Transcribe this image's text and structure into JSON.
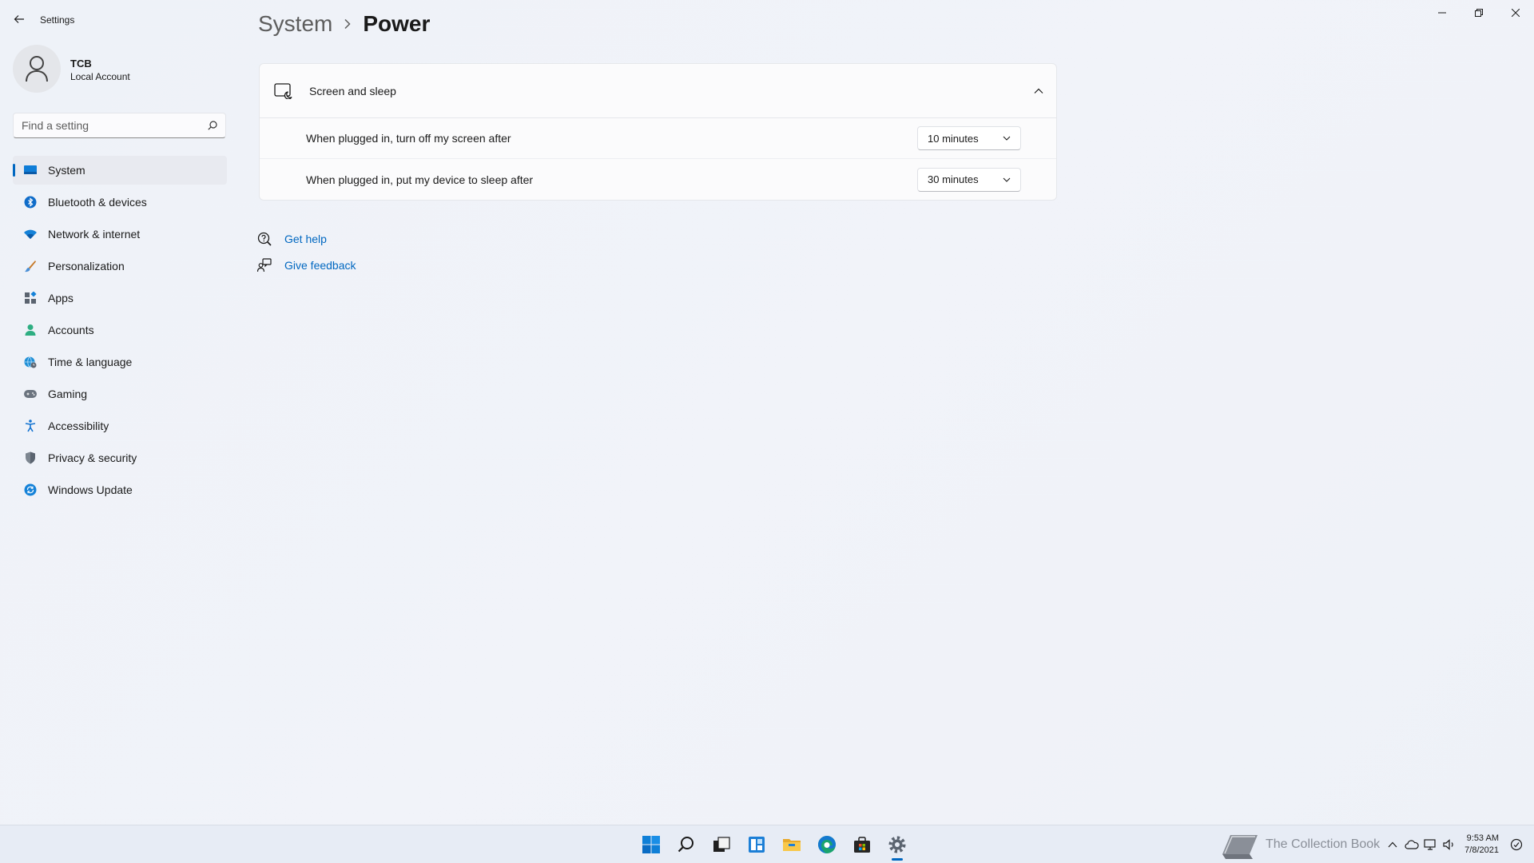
{
  "window": {
    "app_title": "Settings"
  },
  "profile": {
    "name": "TCB",
    "account_type": "Local Account"
  },
  "search": {
    "placeholder": "Find a setting"
  },
  "sidebar": {
    "items": [
      {
        "label": "System",
        "icon": "system-icon",
        "active": true
      },
      {
        "label": "Bluetooth & devices",
        "icon": "bluetooth-icon"
      },
      {
        "label": "Network & internet",
        "icon": "wifi-icon"
      },
      {
        "label": "Personalization",
        "icon": "brush-icon"
      },
      {
        "label": "Apps",
        "icon": "apps-icon"
      },
      {
        "label": "Accounts",
        "icon": "person-icon"
      },
      {
        "label": "Time & language",
        "icon": "globe-clock-icon"
      },
      {
        "label": "Gaming",
        "icon": "gamepad-icon"
      },
      {
        "label": "Accessibility",
        "icon": "accessibility-icon"
      },
      {
        "label": "Privacy & security",
        "icon": "shield-icon"
      },
      {
        "label": "Windows Update",
        "icon": "update-icon"
      }
    ]
  },
  "breadcrumb": {
    "parent": "System",
    "current": "Power"
  },
  "screen_sleep": {
    "title": "Screen and sleep",
    "rows": [
      {
        "label": "When plugged in, turn off my screen after",
        "value": "10 minutes"
      },
      {
        "label": "When plugged in, put my device to sleep after",
        "value": "30 minutes"
      }
    ]
  },
  "links": {
    "help": "Get help",
    "feedback": "Give feedback"
  },
  "taskbar": {
    "watermark": "The Collection Book",
    "time": "9:53 AM",
    "date": "7/8/2021"
  },
  "colors": {
    "accent": "#0067c0",
    "background": "#eff2f8"
  }
}
